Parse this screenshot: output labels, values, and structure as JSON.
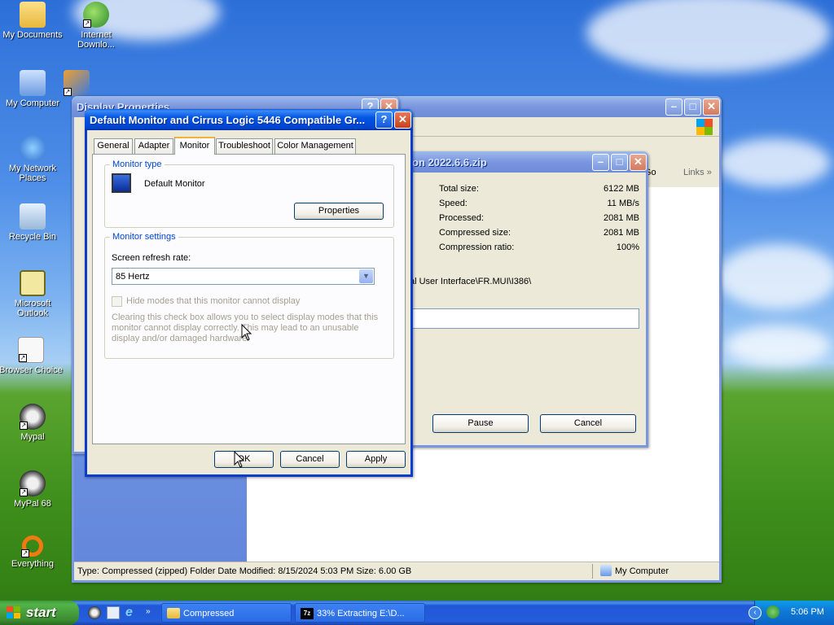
{
  "desktop": {
    "icons": [
      {
        "label": "My Documents"
      },
      {
        "label": "Internet Downlo..."
      },
      {
        "label": "My Computer"
      },
      {
        "label": "My Network Places"
      },
      {
        "label": "Recycle Bin"
      },
      {
        "label": "Microsoft Outlook"
      },
      {
        "label": "Browser Choice"
      },
      {
        "label": "Mypal"
      },
      {
        "label": "MyPal 68"
      },
      {
        "label": "Everything"
      }
    ]
  },
  "display_properties": {
    "title": "Display Properties"
  },
  "explorer": {
    "go_label": "Go",
    "links_label": "Links",
    "status_text": "Type: Compressed (zipped) Folder Date Modified: 8/15/2024 5:03 PM Size: 6.00 GB",
    "status_zone": "My Computer"
  },
  "extract": {
    "title": "on 2022.6.6.zip",
    "stats": [
      {
        "label": "Total size:",
        "value": "6122 MB"
      },
      {
        "label": "Speed:",
        "value": "11 MB/s"
      },
      {
        "label": "Processed:",
        "value": "2081 MB"
      },
      {
        "label": "Compressed size:",
        "value": "2081 MB"
      },
      {
        "label": "Compression ratio:",
        "value": "100%"
      }
    ],
    "path": "al User Interface\\FR.MUI\\I386\\",
    "pause_label": "Pause",
    "cancel_label": "Cancel"
  },
  "monitor_dialog": {
    "title": "Default Monitor and Cirrus Logic 5446 Compatible Gr...",
    "tabs": [
      "General",
      "Adapter",
      "Monitor",
      "Troubleshoot",
      "Color Management"
    ],
    "active_tab": "Monitor",
    "monitor_type_legend": "Monitor type",
    "monitor_name": "Default Monitor",
    "properties_label": "Properties",
    "settings_legend": "Monitor settings",
    "refresh_label": "Screen refresh rate:",
    "refresh_value": "85 Hertz",
    "hide_modes_label": "Hide modes that this monitor cannot display",
    "hide_modes_note": "Clearing this check box allows you to select display modes that this monitor cannot display correctly. This may lead to an unusable display and/or damaged hardware.",
    "ok_label": "OK",
    "cancel_label": "Cancel",
    "apply_label": "Apply"
  },
  "taskbar": {
    "start_label": "start",
    "tasks": [
      {
        "label": "Compressed"
      },
      {
        "label": "33% Extracting E:\\D..."
      }
    ],
    "clock": "5:06 PM"
  }
}
